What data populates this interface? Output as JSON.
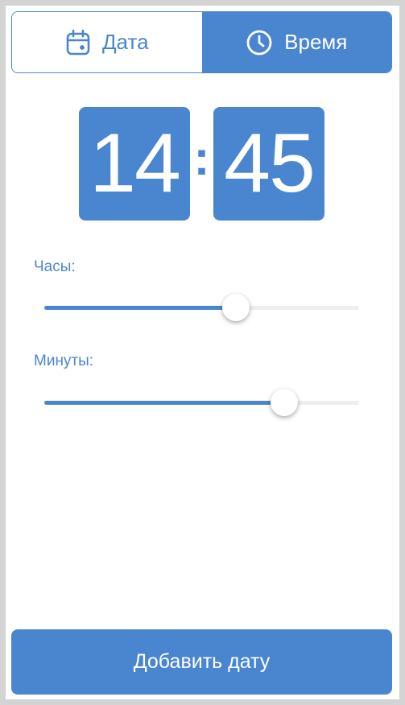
{
  "tabs": {
    "date_label": "Дата",
    "time_label": "Время",
    "active": "time"
  },
  "time": {
    "hours": "14",
    "separator": ":",
    "minutes": "45"
  },
  "sliders": {
    "hours": {
      "label": "Часы:",
      "value": 14,
      "min": 0,
      "max": 23
    },
    "minutes": {
      "label": "Минуты:",
      "value": 45,
      "min": 0,
      "max": 59
    }
  },
  "add_button": {
    "label": "Добавить дату"
  },
  "colors": {
    "accent": "#4a86cf",
    "track": "#eeeeee",
    "background": "#ffffff",
    "outer": "#d4d4d4"
  },
  "icons": {
    "date_tab": "calendar-icon",
    "time_tab": "clock-icon"
  }
}
